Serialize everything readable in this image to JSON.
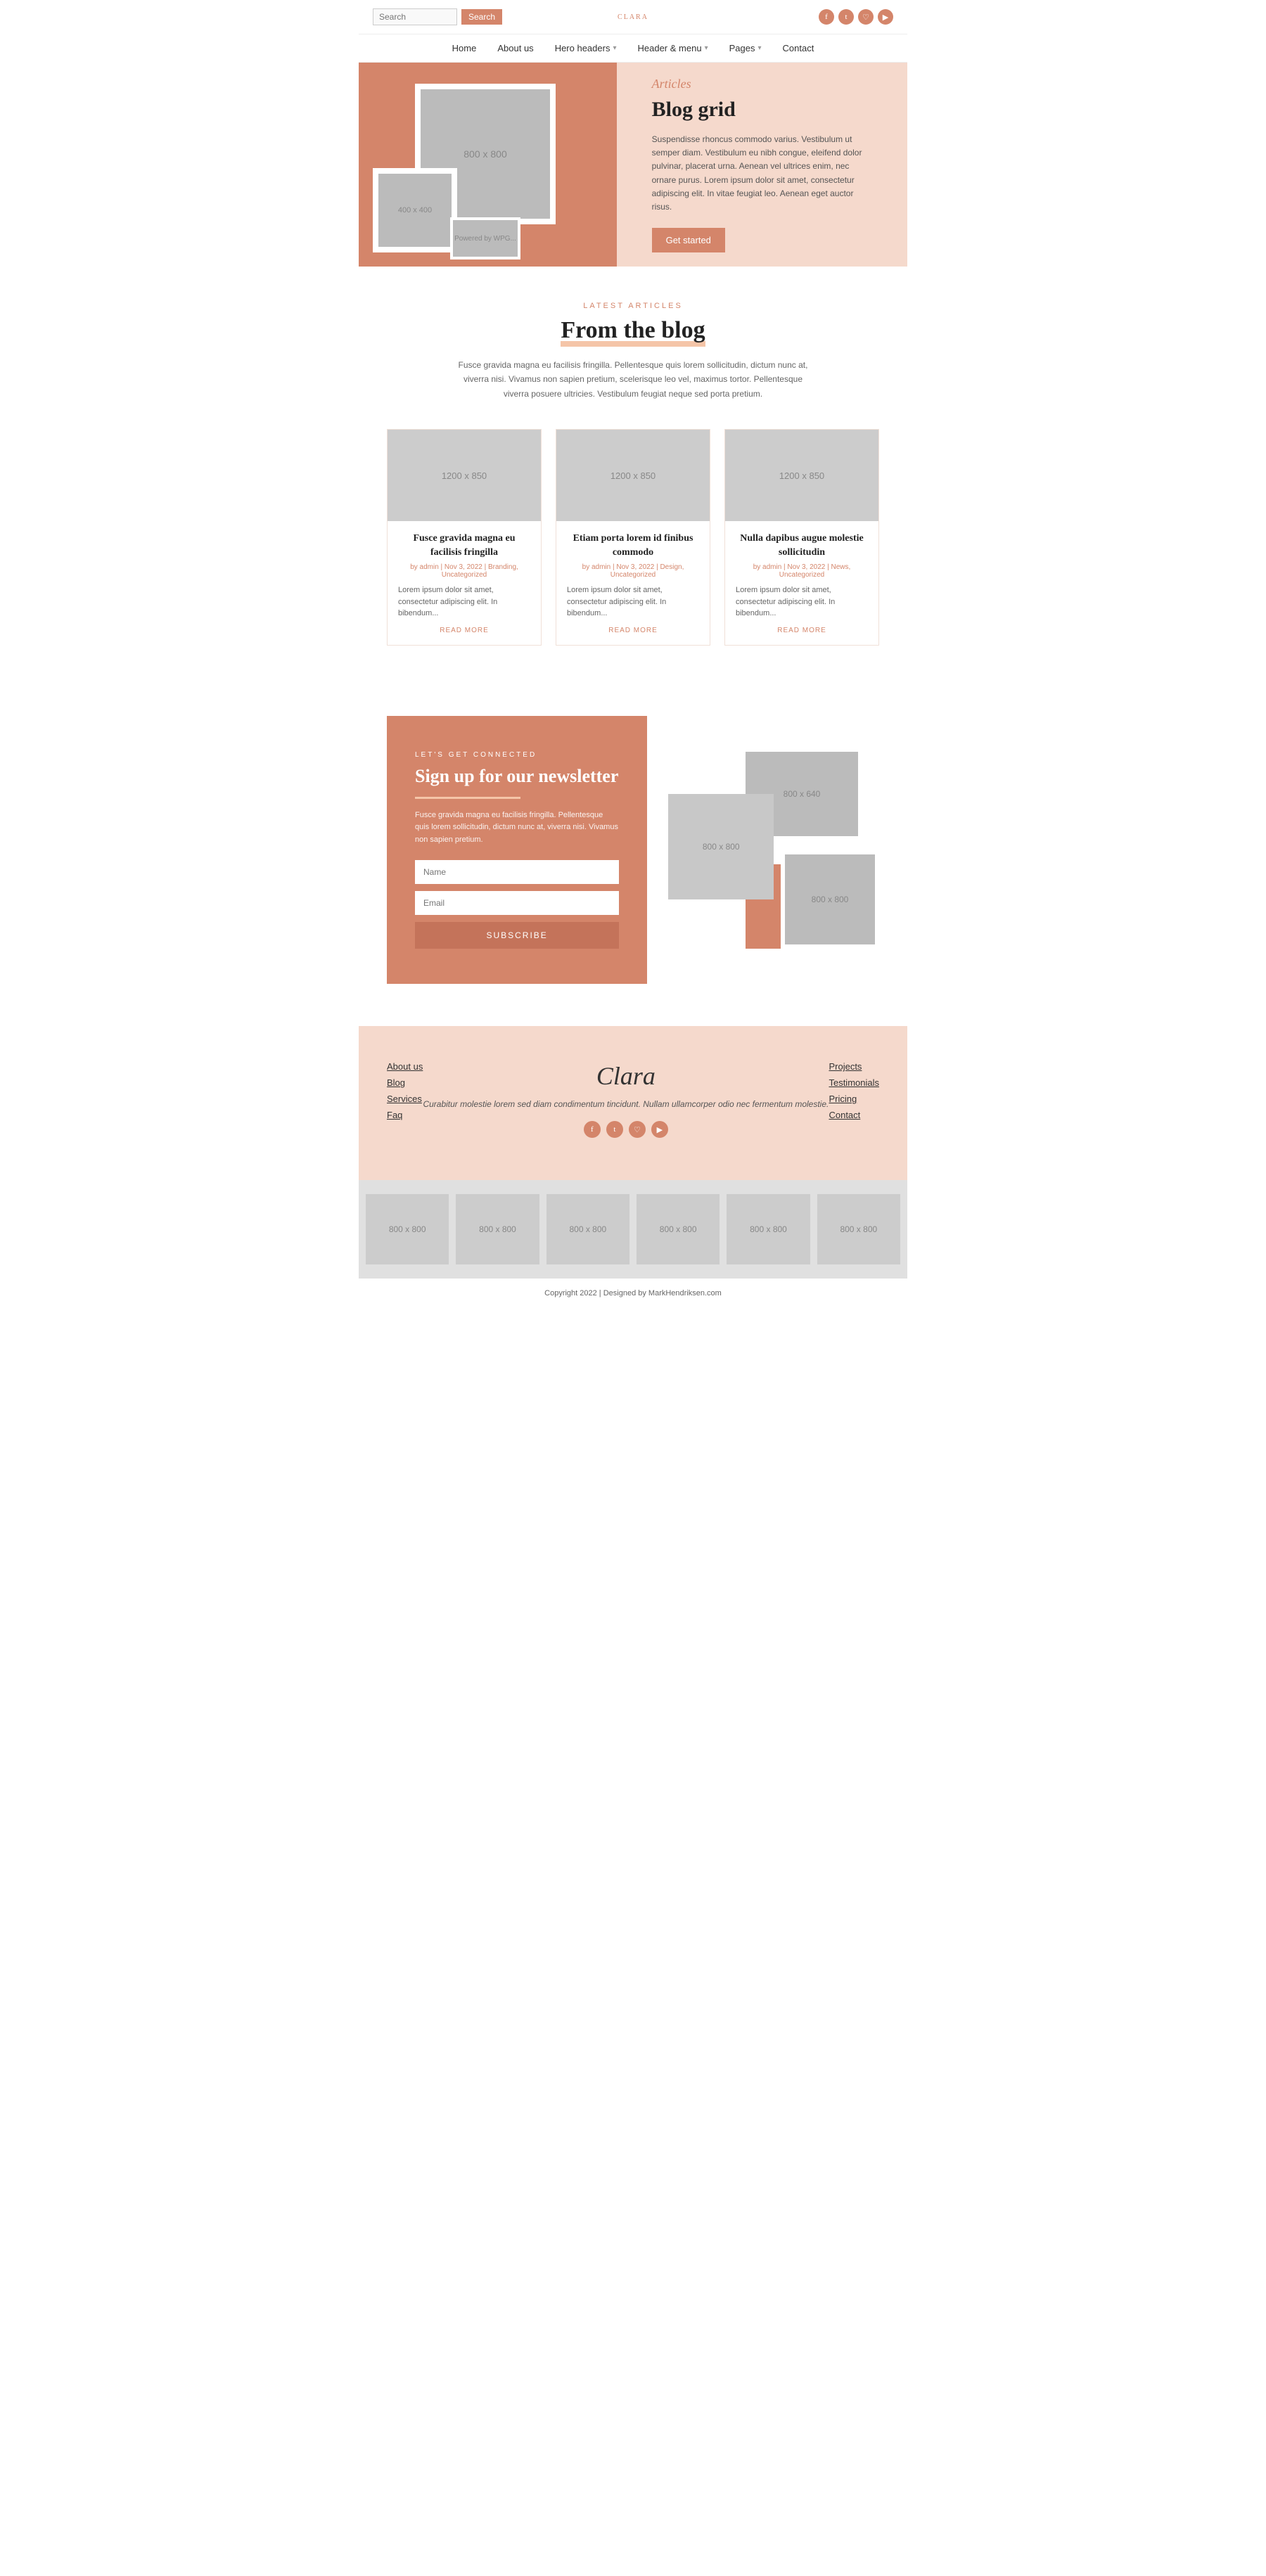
{
  "header": {
    "search_placeholder": "Search",
    "search_button": "Search",
    "logo_text": "Clara",
    "logo_tagline": "──────",
    "social": [
      "f",
      "t",
      "in",
      "yt"
    ],
    "nav": [
      {
        "label": "Home",
        "has_arrow": false
      },
      {
        "label": "About us",
        "has_arrow": false
      },
      {
        "label": "Hero headers",
        "has_arrow": true
      },
      {
        "label": "Header & menu",
        "has_arrow": true
      },
      {
        "label": "Pages",
        "has_arrow": true
      },
      {
        "label": "Contact",
        "has_arrow": false
      }
    ]
  },
  "hero": {
    "img_main": "800 x 800",
    "img_small": "400 x 400",
    "img_tiny": "Powered by WPG...",
    "subtitle": "Articles",
    "title": "Blog grid",
    "description": "Suspendisse rhoncus commodo varius. Vestibulum ut semper diam. Vestibulum eu nibh congue, eleifend dolor pulvinar, placerat urna. Aenean vel ultrices enim, nec ornare purus. Lorem ipsum dolor sit amet, consectetur adipiscing elit. In vitae feugiat leo. Aenean eget auctor risus.",
    "button": "Get started"
  },
  "blog": {
    "label": "LATEST ARTICLES",
    "title": "From the blog",
    "description": "Fusce gravida magna eu facilisis fringilla. Pellentesque quis lorem sollicitudin, dictum nunc at, viverra nisi. Vivamus non sapien pretium, scelerisque leo vel, maximus tortor. Pellentesque viverra posuere ultricies. Vestibulum feugiat neque sed porta pretium.",
    "cards": [
      {
        "img": "1200 x 850",
        "title": "Fusce gravida magna eu facilisis fringilla",
        "meta": "by admin | Nov 3, 2022 | Branding, Uncategorized",
        "excerpt": "Lorem ipsum dolor sit amet, consectetur adipiscing elit. In bibendum...",
        "read_more": "READ MORE"
      },
      {
        "img": "1200 x 850",
        "title": "Etiam porta lorem id finibus commodo",
        "meta": "by admin | Nov 3, 2022 | Design, Uncategorized",
        "excerpt": "Lorem ipsum dolor sit amet, consectetur adipiscing elit. In bibendum...",
        "read_more": "READ MORE"
      },
      {
        "img": "1200 x 850",
        "title": "Nulla dapibus augue molestie sollicitudin",
        "meta": "by admin | Nov 3, 2022 | News, Uncategorized",
        "excerpt": "Lorem ipsum dolor sit amet, consectetur adipiscing elit. In bibendum...",
        "read_more": "READ MORE"
      }
    ]
  },
  "newsletter": {
    "label": "LET'S GET CONNECTED",
    "title": "Sign up for our newsletter",
    "description": "Fusce gravida magna eu facilisis fringilla. Pellentesque quis lorem sollicitudin, dictum nunc at, viverra nisi. Vivamus non sapien pretium.",
    "name_placeholder": "Name",
    "email_placeholder": "Email",
    "button": "SUBSCRIBE",
    "img1": "800 x 640",
    "img2": "800 x 800",
    "img3": "800 x 800"
  },
  "footer": {
    "links_left": [
      {
        "label": "About us"
      },
      {
        "label": "Blog"
      },
      {
        "label": "Services"
      },
      {
        "label": "Faq"
      }
    ],
    "links_right": [
      {
        "label": "Projects"
      },
      {
        "label": "Testimonials"
      },
      {
        "label": "Pricing"
      },
      {
        "label": "Contact"
      }
    ],
    "logo": "Clara",
    "tagline": "Curabitur molestie lorem sed diam condimentum tincidunt. Nullam ullamcorper odio nec fermentum molestie.",
    "social": [
      "f",
      "t",
      "in",
      "yt"
    ]
  },
  "gallery": {
    "items": [
      "800 x 800",
      "800 x 800",
      "800 x 800",
      "800 x 800",
      "800 x 800",
      "800 x 800"
    ]
  },
  "copyright": {
    "text": "Copyright 2022 | Designed by MarkHendriksen.com"
  }
}
